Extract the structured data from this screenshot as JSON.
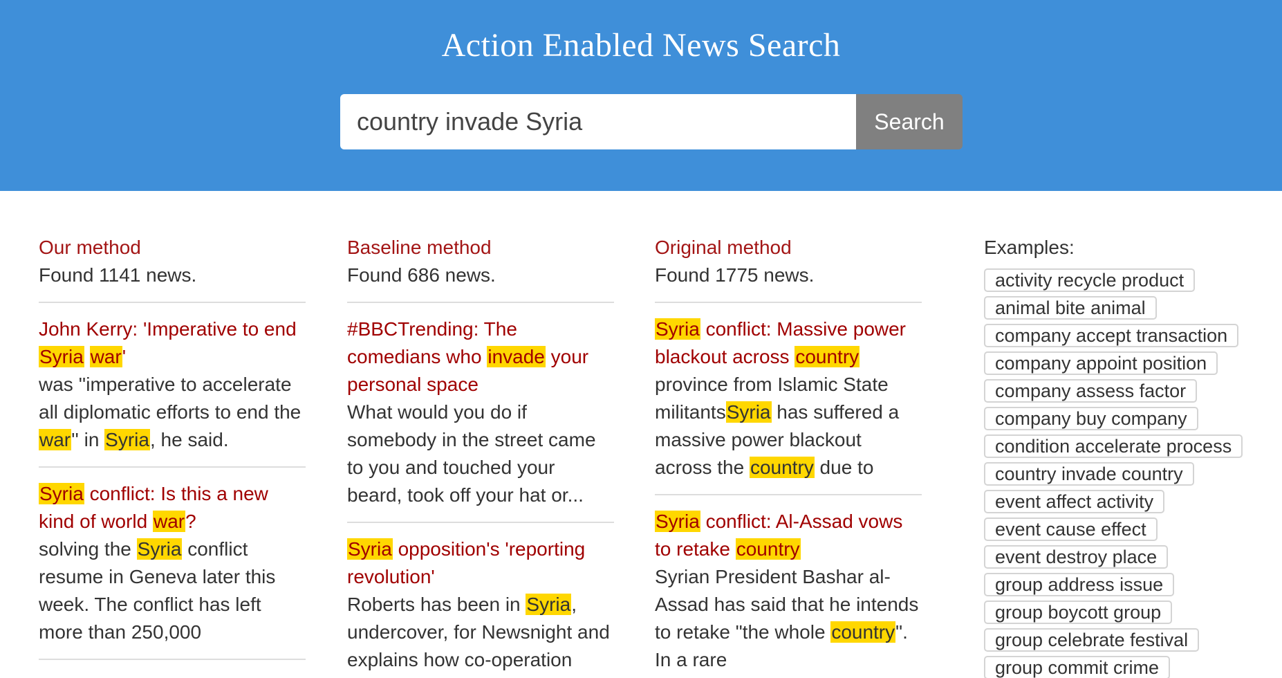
{
  "app": {
    "title": "Action Enabled News Search"
  },
  "search": {
    "value": "country invade Syria",
    "button_label": "Search"
  },
  "columns": [
    {
      "title": "Our method",
      "found": "Found 1141 news.",
      "articles": [
        {
          "title": [
            {
              "t": "John Kerry: 'Imperative to end "
            },
            {
              "t": "Syria",
              "h": true
            },
            {
              "t": " "
            },
            {
              "t": "war",
              "h": true
            },
            {
              "t": "'"
            }
          ],
          "snippet": [
            {
              "t": "was ''imperative to accelerate all diplomatic efforts to end the "
            },
            {
              "t": "war",
              "h": true
            },
            {
              "t": "'' in "
            },
            {
              "t": "Syria",
              "h": true
            },
            {
              "t": ", he said."
            }
          ]
        },
        {
          "title": [
            {
              "t": "Syria",
              "h": true
            },
            {
              "t": " conflict: Is this a new kind of world "
            },
            {
              "t": "war",
              "h": true
            },
            {
              "t": "?"
            }
          ],
          "snippet": [
            {
              "t": "solving the "
            },
            {
              "t": "Syria",
              "h": true
            },
            {
              "t": " conflict resume in Geneva later this week. The conflict has left more than 250,000"
            }
          ]
        }
      ]
    },
    {
      "title": "Baseline method",
      "found": "Found 686 news.",
      "articles": [
        {
          "title": [
            {
              "t": "#BBCTrending: The comedians who "
            },
            {
              "t": "invade",
              "h": true
            },
            {
              "t": " your personal space"
            }
          ],
          "snippet": [
            {
              "t": "What would you do if somebody in the street came to you and touched your beard, took off your hat or..."
            }
          ]
        },
        {
          "title": [
            {
              "t": "Syria",
              "h": true
            },
            {
              "t": " opposition's 'reporting revolution'"
            }
          ],
          "snippet": [
            {
              "t": "Roberts has been in "
            },
            {
              "t": "Syria",
              "h": true
            },
            {
              "t": ", undercover, for Newsnight and explains how co-operation"
            }
          ]
        }
      ]
    },
    {
      "title": "Original method",
      "found": "Found 1775 news.",
      "articles": [
        {
          "title": [
            {
              "t": "Syria",
              "h": true
            },
            {
              "t": " conflict: Massive power blackout across "
            },
            {
              "t": "country",
              "h": true
            }
          ],
          "snippet": [
            {
              "t": "province from Islamic State militants"
            },
            {
              "t": "Syria",
              "h": true
            },
            {
              "t": " has suffered a massive power blackout across the "
            },
            {
              "t": "country",
              "h": true
            },
            {
              "t": " due to"
            }
          ]
        },
        {
          "title": [
            {
              "t": "Syria",
              "h": true
            },
            {
              "t": " conflict: Al-Assad vows to retake "
            },
            {
              "t": "country",
              "h": true
            }
          ],
          "snippet": [
            {
              "t": "Syrian President Bashar al-Assad has said that he intends to retake \"the whole "
            },
            {
              "t": "country",
              "h": true
            },
            {
              "t": "\". In a rare"
            }
          ]
        }
      ]
    }
  ],
  "examples": {
    "label": "Examples:",
    "items": [
      "activity recycle product",
      "animal bite animal",
      "company accept transaction",
      "company appoint position",
      "company assess factor",
      "company buy company",
      "condition accelerate process",
      "country invade country",
      "event affect activity",
      "event cause effect",
      "event destroy place",
      "group address issue",
      "group boycott group",
      "group celebrate festival",
      "group commit crime"
    ]
  },
  "colors": {
    "header_bg": "#3f8fd9",
    "accent_red": "#a31515",
    "highlight": "#ffd700",
    "search_button": "#808080"
  }
}
